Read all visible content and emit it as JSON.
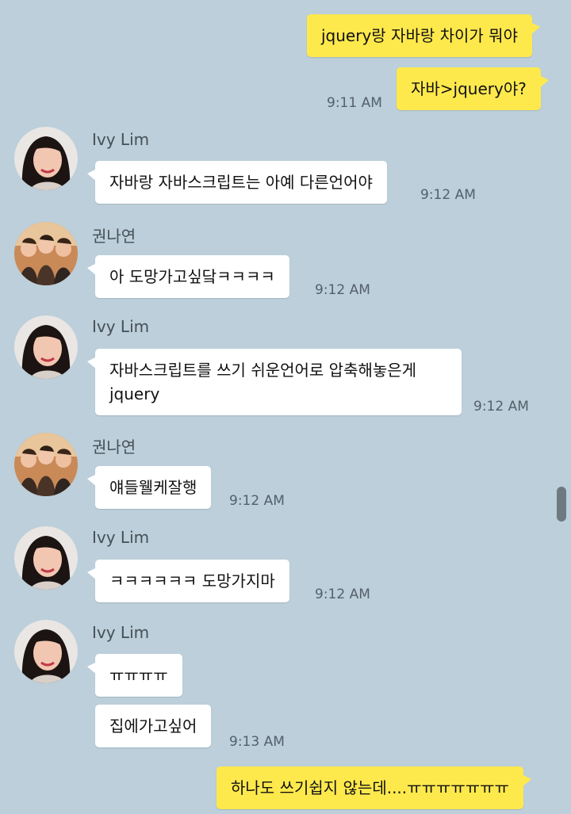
{
  "messages": {
    "m1": "jquery랑 자바랑 차이가 뭐야",
    "m2": "자바>jquery야?",
    "m2_time": "9:11 AM",
    "m3_sender": "Ivy Lim",
    "m3": "자바랑 자바스크립트는 아예 다른언어야",
    "m3_time": "9:12 AM",
    "m4_sender": "권나연",
    "m4": "아 도망가고싶닼ㅋㅋㅋㅋ",
    "m4_time": "9:12 AM",
    "m5_sender": "Ivy Lim",
    "m5_line1": "자바스크립트를 쓰기 쉬운언어로 압축해놓은게",
    "m5_line2": "jquery",
    "m5_time": "9:12 AM",
    "m6_sender": "권나연",
    "m6": "얘들웰케잘행",
    "m6_time": "9:12 AM",
    "m7_sender": "Ivy Lim",
    "m7": "ㅋㅋㅋㅋㅋㅋ 도망가지마",
    "m7_time": "9:12 AM",
    "m8_sender": "Ivy Lim",
    "m8a": "ㅠㅠㅠㅠ",
    "m8b": "집에가고싶어",
    "m8_time": "9:13 AM",
    "m9": "하나도 쓰기쉽지 않는데....ㅠㅠㅠㅠㅠㅠㅠ"
  },
  "colors": {
    "background": "#bccfda",
    "outgoing_bubble": "#fee94d",
    "incoming_bubble": "#ffffff"
  },
  "icons": {
    "ivy_avatar": "profile-photo-ivy-lim",
    "group_avatar": "profile-photo-group"
  }
}
